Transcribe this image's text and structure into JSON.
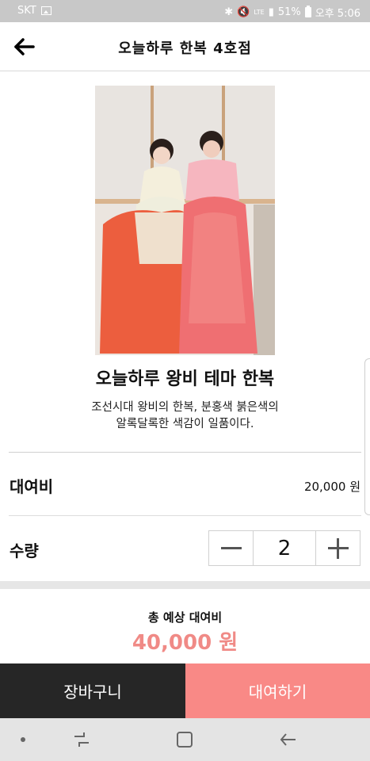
{
  "status_bar": {
    "carrier": "SKT",
    "network": "LTE",
    "battery": "51%",
    "time": "오후 5:06"
  },
  "header": {
    "title": "오늘하루 한복 4호점"
  },
  "product": {
    "name": "오늘하루 왕비 테마 한복",
    "description_lines": [
      "조선시대 왕비의 한복, 분홍색 붉은색의",
      "알록달록한 색감이 일품이다."
    ]
  },
  "fee": {
    "label": "대여비",
    "value": "20,000 원"
  },
  "quantity": {
    "label": "수량",
    "value": "2"
  },
  "total": {
    "label": "총 예상 대여비",
    "value": "40,000 원"
  },
  "buttons": {
    "cart": "장바구니",
    "rent": "대여하기"
  },
  "colors": {
    "accent": "#f98986",
    "total_text": "#f08a86",
    "dark_button": "#262626"
  }
}
